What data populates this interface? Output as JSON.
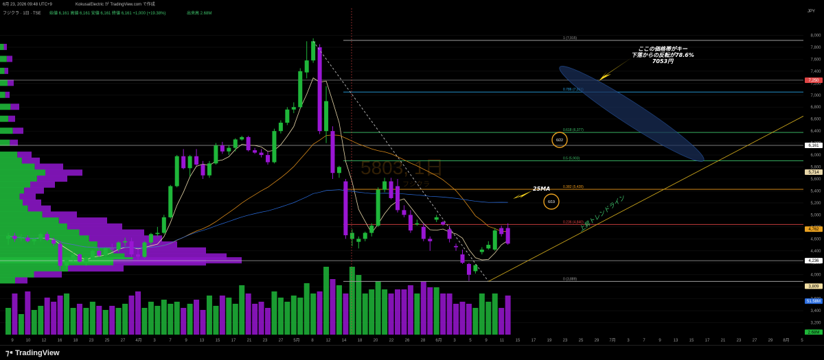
{
  "header": {
    "timestamp": "6月 23, 2026 09:48 UTC+9",
    "author": "KokusaiElectric が TradingView.com で作成",
    "symbol": "フジクラ · 1日 · TSE",
    "ohlc": "始値 6,161  高値 6,161  安値 6,161  終値 6,161  +1,000 (+19.38%)",
    "volume": "出来高 2.68M",
    "currency": "JPY"
  },
  "watermark": {
    "code": "5803, 1日",
    "name": "フジクラ"
  },
  "colors": {
    "bull": "#1fb73a",
    "bear": "#9a16d4",
    "background": "#000000",
    "fib_top": "#9e9e9e",
    "fib_786": "#2aa7e8",
    "fib_618": "#3ec26b",
    "fib_5": "#3ec26b",
    "fib_382": "#f29c1b",
    "fib_236": "#e04545",
    "fib_0": "#9e9e9e",
    "ma25": "#e7d6a8",
    "ma_orange": "#d98a1a",
    "trendline": "#c8a31b"
  },
  "chart_data": {
    "type": "candlestick",
    "currency": "JPY",
    "ylim": [
      3000,
      8200
    ],
    "y_ticks": [
      3200,
      3400,
      3600,
      3800,
      4000,
      4200,
      4400,
      4600,
      4800,
      5000,
      5200,
      5400,
      5600,
      5800,
      6000,
      6200,
      6400,
      6600,
      6800,
      7000,
      7200,
      7400,
      7600,
      7800,
      8000
    ],
    "x_tick_labels": [
      "9",
      "10",
      "12",
      "16",
      "18",
      "23",
      "25",
      "27",
      "4月",
      "3",
      "7",
      "9",
      "13",
      "15",
      "17",
      "21",
      "23",
      "27",
      "5月",
      "8",
      "12",
      "14",
      "18",
      "20",
      "22",
      "26",
      "28",
      "6月",
      "3",
      "5",
      "9",
      "11",
      "15",
      "17",
      "19",
      "23",
      "25",
      "29",
      "7月",
      "3",
      "7",
      "9",
      "13",
      "15",
      "17",
      "21",
      "23",
      "27",
      "29",
      "8月",
      "5"
    ],
    "candles": [
      {
        "o": 4600,
        "h": 4700,
        "l": 4500,
        "c": 4650
      },
      {
        "o": 4650,
        "h": 4700,
        "l": 4550,
        "c": 4600
      },
      {
        "o": 4600,
        "h": 4680,
        "l": 4560,
        "c": 4620
      },
      {
        "o": 4620,
        "h": 4660,
        "l": 4540,
        "c": 4560
      },
      {
        "o": 4560,
        "h": 4620,
        "l": 4500,
        "c": 4600
      },
      {
        "o": 4600,
        "h": 4700,
        "l": 4560,
        "c": 4680
      },
      {
        "o": 4680,
        "h": 4720,
        "l": 4560,
        "c": 4580
      },
      {
        "o": 4580,
        "h": 4620,
        "l": 4480,
        "c": 4520
      },
      {
        "o": 4520,
        "h": 4560,
        "l": 4080,
        "c": 4150
      },
      {
        "o": 4150,
        "h": 4300,
        "l": 4100,
        "c": 4250
      },
      {
        "o": 4250,
        "h": 4380,
        "l": 4200,
        "c": 4340
      },
      {
        "o": 4340,
        "h": 4360,
        "l": 4200,
        "c": 4220
      },
      {
        "o": 4220,
        "h": 4300,
        "l": 4150,
        "c": 4270
      },
      {
        "o": 4270,
        "h": 4420,
        "l": 4240,
        "c": 4400
      },
      {
        "o": 4400,
        "h": 4460,
        "l": 4300,
        "c": 4320
      },
      {
        "o": 4320,
        "h": 4460,
        "l": 4300,
        "c": 4440
      },
      {
        "o": 4440,
        "h": 4520,
        "l": 4380,
        "c": 4420
      },
      {
        "o": 4420,
        "h": 4560,
        "l": 4380,
        "c": 4540
      },
      {
        "o": 4540,
        "h": 4620,
        "l": 4480,
        "c": 4560
      },
      {
        "o": 4560,
        "h": 4620,
        "l": 4300,
        "c": 4340
      },
      {
        "o": 4340,
        "h": 4420,
        "l": 4250,
        "c": 4300
      },
      {
        "o": 4300,
        "h": 4560,
        "l": 4280,
        "c": 4540
      },
      {
        "o": 4540,
        "h": 4700,
        "l": 4500,
        "c": 4680
      },
      {
        "o": 4680,
        "h": 4800,
        "l": 4640,
        "c": 4700
      },
      {
        "o": 4700,
        "h": 5000,
        "l": 4680,
        "c": 4960
      },
      {
        "o": 4960,
        "h": 5500,
        "l": 4940,
        "c": 5480
      },
      {
        "o": 5480,
        "h": 6000,
        "l": 5460,
        "c": 5980
      },
      {
        "o": 5980,
        "h": 6100,
        "l": 5760,
        "c": 5780
      },
      {
        "o": 5780,
        "h": 6000,
        "l": 5640,
        "c": 5980
      },
      {
        "o": 5980,
        "h": 6100,
        "l": 5820,
        "c": 5840
      },
      {
        "o": 5840,
        "h": 5900,
        "l": 5600,
        "c": 5660
      },
      {
        "o": 5660,
        "h": 5900,
        "l": 5620,
        "c": 5860
      },
      {
        "o": 5860,
        "h": 6200,
        "l": 5840,
        "c": 6160
      },
      {
        "o": 6160,
        "h": 6220,
        "l": 6020,
        "c": 6060
      },
      {
        "o": 6060,
        "h": 6160,
        "l": 6000,
        "c": 6120
      },
      {
        "o": 6120,
        "h": 6280,
        "l": 6060,
        "c": 6260
      },
      {
        "o": 6260,
        "h": 6320,
        "l": 6240,
        "c": 6300
      },
      {
        "o": 6300,
        "h": 6320,
        "l": 6060,
        "c": 6080
      },
      {
        "o": 6080,
        "h": 6120,
        "l": 6020,
        "c": 6040
      },
      {
        "o": 6040,
        "h": 6100,
        "l": 5960,
        "c": 6000
      },
      {
        "o": 6000,
        "h": 6060,
        "l": 5840,
        "c": 5880
      },
      {
        "o": 5880,
        "h": 6440,
        "l": 5860,
        "c": 6400
      },
      {
        "o": 6400,
        "h": 6580,
        "l": 6360,
        "c": 6540
      },
      {
        "o": 6540,
        "h": 6800,
        "l": 6500,
        "c": 6760
      },
      {
        "o": 6760,
        "h": 6880,
        "l": 6700,
        "c": 6800
      },
      {
        "o": 6800,
        "h": 7450,
        "l": 6780,
        "c": 7400
      },
      {
        "o": 7380,
        "h": 7900,
        "l": 7280,
        "c": 7580
      },
      {
        "o": 7580,
        "h": 7950,
        "l": 7540,
        "c": 7900
      },
      {
        "o": 7800,
        "h": 7850,
        "l": 6350,
        "c": 6400
      },
      {
        "o": 6400,
        "h": 7150,
        "l": 6200,
        "c": 6900
      },
      {
        "o": 6400,
        "h": 6480,
        "l": 5600,
        "c": 5700
      },
      {
        "o": 5700,
        "h": 5820,
        "l": 5620,
        "c": 5800
      },
      {
        "o": 5560,
        "h": 5600,
        "l": 4600,
        "c": 4660
      },
      {
        "o": 4600,
        "h": 4760,
        "l": 4480,
        "c": 4700
      },
      {
        "o": 4550,
        "h": 4640,
        "l": 4440,
        "c": 4600
      },
      {
        "o": 4600,
        "h": 4720,
        "l": 4560,
        "c": 4700
      },
      {
        "o": 4700,
        "h": 4860,
        "l": 4640,
        "c": 4820
      },
      {
        "o": 4820,
        "h": 5460,
        "l": 4800,
        "c": 5420
      },
      {
        "o": 5420,
        "h": 5620,
        "l": 5380,
        "c": 5560
      },
      {
        "o": 5560,
        "h": 5620,
        "l": 5260,
        "c": 5280
      },
      {
        "o": 5480,
        "h": 5600,
        "l": 5040,
        "c": 5080
      },
      {
        "o": 5080,
        "h": 5160,
        "l": 4960,
        "c": 5000
      },
      {
        "o": 5000,
        "h": 5080,
        "l": 4700,
        "c": 4740
      },
      {
        "o": 4840,
        "h": 4920,
        "l": 4820,
        "c": 4860
      },
      {
        "o": 4800,
        "h": 4860,
        "l": 4560,
        "c": 4600
      },
      {
        "o": 4600,
        "h": 4640,
        "l": 4400,
        "c": 4560
      },
      {
        "o": 4920,
        "h": 5000,
        "l": 4880,
        "c": 4960
      },
      {
        "o": 4880,
        "h": 4900,
        "l": 4820,
        "c": 4840
      },
      {
        "o": 4760,
        "h": 4820,
        "l": 4540,
        "c": 4600
      },
      {
        "o": 4480,
        "h": 4520,
        "l": 4400,
        "c": 4460
      },
      {
        "o": 4340,
        "h": 4420,
        "l": 4180,
        "c": 4200
      },
      {
        "o": 4180,
        "h": 4200,
        "l": 3900,
        "c": 4000
      },
      {
        "o": 4060,
        "h": 4180,
        "l": 4020,
        "c": 4160
      },
      {
        "o": 4380,
        "h": 4460,
        "l": 4340,
        "c": 4420
      },
      {
        "o": 4440,
        "h": 4560,
        "l": 4420,
        "c": 4500
      },
      {
        "o": 4420,
        "h": 4780,
        "l": 4400,
        "c": 4740
      },
      {
        "o": 4780,
        "h": 4820,
        "l": 4640,
        "c": 4680
      },
      {
        "o": 4780,
        "h": 4860,
        "l": 4500,
        "c": 4520
      }
    ],
    "volumes": [
      1.3,
      2.0,
      1.0,
      2.1,
      1.2,
      1.4,
      1.8,
      1.6,
      1.9,
      2.0,
      1.3,
      1.5,
      1.3,
      1.6,
      1.4,
      1.2,
      1.4,
      1.3,
      1.5,
      1.9,
      2.1,
      1.3,
      1.6,
      1.4,
      1.7,
      1.5,
      1.6,
      1.3,
      1.5,
      1.7,
      1.2,
      1.9,
      1.4,
      1.9,
      1.8,
      1.5,
      2.4,
      2.0,
      1.5,
      1.6,
      1.3,
      2.1,
      1.8,
      1.6,
      1.9,
      1.8,
      2.5,
      2.0,
      2.1,
      3.3,
      2.7,
      2.4,
      2.0,
      3.3,
      2.9,
      2.0,
      2.2,
      2.6,
      2.2,
      2.0,
      2.2,
      2.2,
      2.4,
      2.0,
      2.6,
      2.3,
      2.3,
      2.0,
      2.0,
      1.5,
      1.6,
      1.5,
      1.3,
      2.0,
      1.6,
      2.0,
      1.3,
      1.9
    ],
    "fib_levels": [
      {
        "label": "1 (7,915)",
        "value": 7915,
        "color": "#9e9e9e"
      },
      {
        "label": "0.786 (7,053)",
        "value": 7053,
        "color": "#2aa7e8"
      },
      {
        "label": "0.618 (6,377)",
        "value": 6377,
        "color": "#3ec26b"
      },
      {
        "label": "0.5 (5,903)",
        "value": 5903,
        "color": "#3ec26b"
      },
      {
        "label": "0.382 (5,428)",
        "value": 5428,
        "color": "#f29c1b"
      },
      {
        "label": "0.236 (4,840)",
        "value": 4840,
        "color": "#e04545"
      },
      {
        "label": "0 (3,889)",
        "value": 3889,
        "color": "#9e9e9e"
      }
    ],
    "horizontal_lines": [
      7250,
      6161,
      4236
    ],
    "price_tags": [
      {
        "text": "7,250",
        "value": 7250,
        "bg": "#e04545",
        "fg": "#ffffff"
      },
      {
        "text": "6,161",
        "value": 6161,
        "bg": "#ffffff",
        "fg": "#000000"
      },
      {
        "text": "5,714",
        "value": 5714,
        "bg": "#e7d6a8",
        "fg": "#000000"
      },
      {
        "text": "4,762",
        "value": 4762,
        "bg": "#e8a020",
        "fg": "#000000"
      },
      {
        "text": "4,236",
        "value": 4236,
        "bg": "#ffffff",
        "fg": "#000000"
      },
      {
        "text": "3,809",
        "value": 3809,
        "bg": "#f5e1a4",
        "fg": "#000000"
      },
      {
        "text": "51.58M",
        "value": 3560,
        "bg": "#2a6de0",
        "fg": "#ffffff"
      },
      {
        "text": "2.68M",
        "value": 3040,
        "bg": "#1fb73a",
        "fg": "#000000"
      }
    ],
    "annotations": {
      "key_zone": [
        "ここの価格帯がキー",
        "下落からの反転が78.6%",
        "7053円"
      ],
      "ma_label": "25MA",
      "trendline_label": "上昇トレンドライン",
      "circle1": "6/22",
      "circle2": "6/19"
    }
  }
}
